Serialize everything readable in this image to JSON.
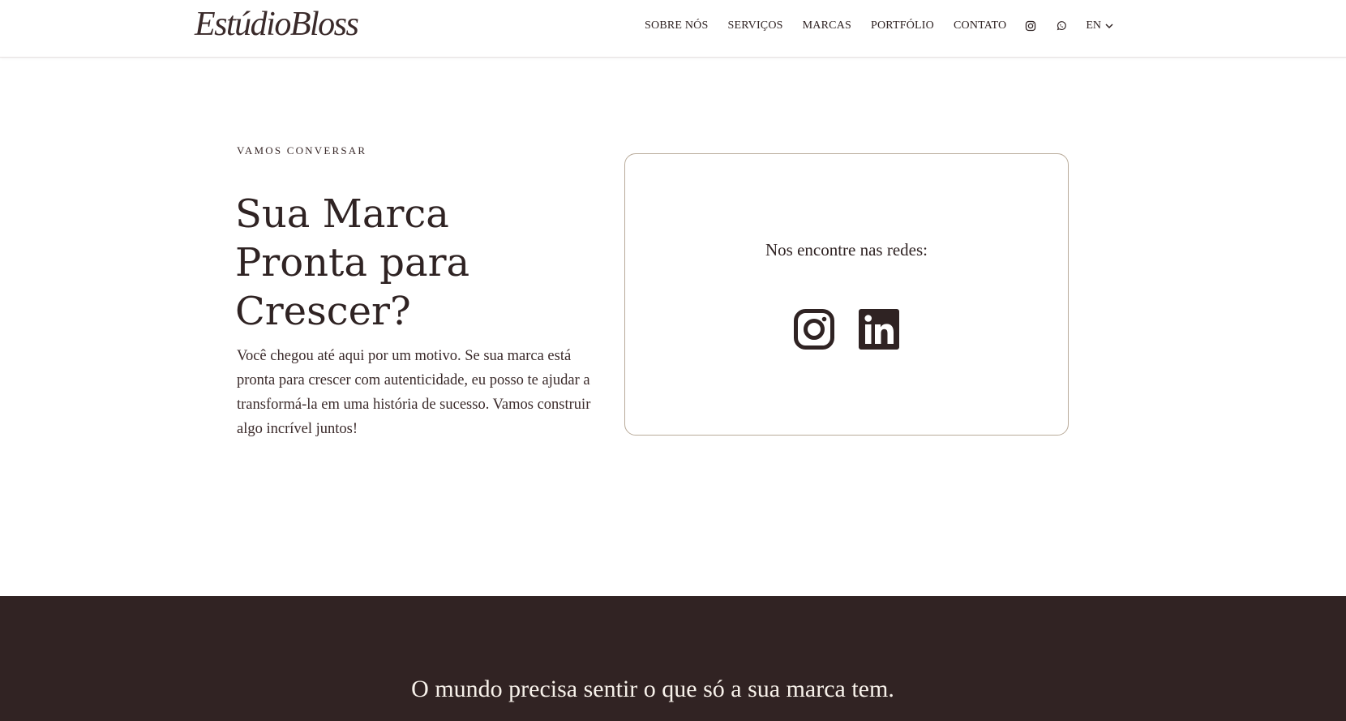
{
  "header": {
    "logo_text": "EstúdioBloss",
    "nav": [
      {
        "label": "SOBRE NÓS"
      },
      {
        "label": "SERVIÇOS"
      },
      {
        "label": "MARCAS"
      },
      {
        "label": "PORTFÓLIO"
      },
      {
        "label": "CONTATO"
      }
    ],
    "icons": [
      "instagram-icon",
      "whatsapp-icon"
    ],
    "language": "EN"
  },
  "contact": {
    "eyebrow": "VAMOS CONVERSAR",
    "headline": "Sua Marca Pronta para Crescer?",
    "body": "Você chegou até aqui por um motivo. Se sua marca está pronta para crescer com autenticidade, eu posso te ajudar a transformá-la em uma história de sucesso. Vamos construir algo incrível juntos!"
  },
  "social_card": {
    "title": "Nos encontre nas redes:",
    "icons": [
      "instagram-icon",
      "linkedin-icon"
    ]
  },
  "footer": {
    "tagline": "O mundo precisa sentir o que só a sua marca tem."
  },
  "colors": {
    "text_dark": "#2f2323",
    "footer_bg": "#312323",
    "footer_text": "#f7f1ea",
    "card_border": "#b9ab9a"
  }
}
